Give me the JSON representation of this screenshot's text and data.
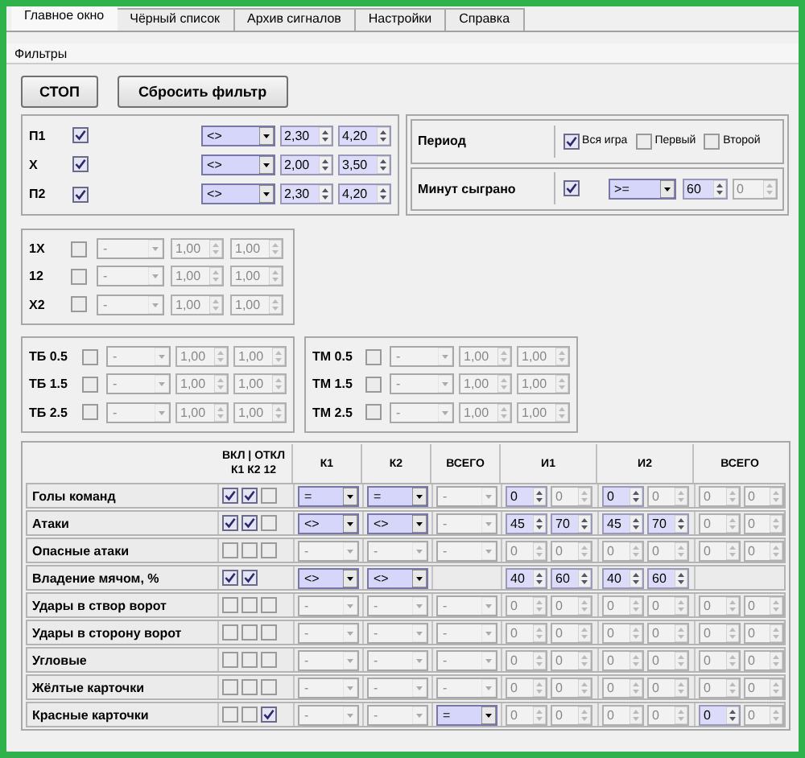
{
  "tabs": [
    {
      "label": "Главное окно",
      "selected": true
    },
    {
      "label": "Чёрный список",
      "selected": false
    },
    {
      "label": "Архив сигналов",
      "selected": false
    },
    {
      "label": "Настройки",
      "selected": false
    },
    {
      "label": "Справка",
      "selected": false
    }
  ],
  "section_title": "Фильтры",
  "buttons": [
    "СТОП",
    "Сбросить фильтр"
  ],
  "odds": {
    "rows": [
      {
        "label": "П1",
        "checked": true,
        "operator": {
          "value": "<>",
          "enabled": true
        },
        "from": {
          "value": "2,30",
          "enabled": true
        },
        "to": {
          "value": "4,20",
          "enabled": true
        }
      },
      {
        "label": "Х",
        "checked": true,
        "operator": {
          "value": "<>",
          "enabled": true
        },
        "from": {
          "value": "2,00",
          "enabled": true
        },
        "to": {
          "value": "3,50",
          "enabled": true
        }
      },
      {
        "label": "П2",
        "checked": true,
        "operator": {
          "value": "<>",
          "enabled": true
        },
        "from": {
          "value": "2,30",
          "enabled": true
        },
        "to": {
          "value": "4,20",
          "enabled": true
        }
      }
    ]
  },
  "period": {
    "label": "Период",
    "options": [
      {
        "label": "Вся игра",
        "checked": true
      },
      {
        "label": "Первый",
        "checked": false
      },
      {
        "label": "Второй",
        "checked": false
      }
    ]
  },
  "minutes": {
    "label": "Минут сыграно",
    "checked": true,
    "operator": {
      "value": ">=",
      "enabled": true
    },
    "from": {
      "value": "60",
      "enabled": true
    },
    "to": {
      "value": "0",
      "enabled": false
    }
  },
  "double_chance": {
    "rows": [
      {
        "label": "1Х",
        "checked": false,
        "operator": {
          "value": "-",
          "enabled": false
        },
        "from": {
          "value": "1,00",
          "enabled": false
        },
        "to": {
          "value": "1,00",
          "enabled": false
        }
      },
      {
        "label": "12",
        "checked": false,
        "operator": {
          "value": "-",
          "enabled": false
        },
        "from": {
          "value": "1,00",
          "enabled": false
        },
        "to": {
          "value": "1,00",
          "enabled": false
        }
      },
      {
        "label": "Х2",
        "checked": false,
        "operator": {
          "value": "-",
          "enabled": false
        },
        "from": {
          "value": "1,00",
          "enabled": false
        },
        "to": {
          "value": "1,00",
          "enabled": false
        }
      }
    ]
  },
  "totals_over": {
    "rows": [
      {
        "label": "ТБ 0.5",
        "checked": false,
        "operator": {
          "value": "-",
          "enabled": false
        },
        "from": {
          "value": "1,00",
          "enabled": false
        },
        "to": {
          "value": "1,00",
          "enabled": false
        }
      },
      {
        "label": "ТБ 1.5",
        "checked": false,
        "operator": {
          "value": "-",
          "enabled": false
        },
        "from": {
          "value": "1,00",
          "enabled": false
        },
        "to": {
          "value": "1,00",
          "enabled": false
        }
      },
      {
        "label": "ТБ 2.5",
        "checked": false,
        "operator": {
          "value": "-",
          "enabled": false
        },
        "from": {
          "value": "1,00",
          "enabled": false
        },
        "to": {
          "value": "1,00",
          "enabled": false
        }
      }
    ]
  },
  "totals_under": {
    "rows": [
      {
        "label": "ТМ 0.5",
        "checked": false,
        "operator": {
          "value": "-",
          "enabled": false
        },
        "from": {
          "value": "1,00",
          "enabled": false
        },
        "to": {
          "value": "1,00",
          "enabled": false
        }
      },
      {
        "label": "ТМ 1.5",
        "checked": false,
        "operator": {
          "value": "-",
          "enabled": false
        },
        "from": {
          "value": "1,00",
          "enabled": false
        },
        "to": {
          "value": "1,00",
          "enabled": false
        }
      },
      {
        "label": "ТМ 2.5",
        "checked": false,
        "operator": {
          "value": "-",
          "enabled": false
        },
        "from": {
          "value": "1,00",
          "enabled": false
        },
        "to": {
          "value": "1,00",
          "enabled": false
        }
      }
    ]
  },
  "stats": {
    "header": {
      "toggle_title": "ВКЛ | ОТКЛ",
      "toggle_subtitle": "К1 К2 12",
      "columns": [
        "К1",
        "К2",
        "ВСЕГО",
        "И1",
        "И2",
        "ВСЕГО"
      ]
    },
    "rows": [
      {
        "label": "Голы команд",
        "checks": [
          {
            "checked": true
          },
          {
            "checked": true
          },
          {
            "checked": false
          }
        ],
        "k1": {
          "value": "=",
          "enabled": true
        },
        "k2": {
          "value": "=",
          "enabled": true
        },
        "total": {
          "value": "-",
          "enabled": false
        },
        "i1": [
          {
            "value": "0",
            "enabled": true
          },
          {
            "value": "0",
            "enabled": false
          }
        ],
        "i2": [
          {
            "value": "0",
            "enabled": true
          },
          {
            "value": "0",
            "enabled": false
          }
        ],
        "sum": [
          {
            "value": "0",
            "enabled": false
          },
          {
            "value": "0",
            "enabled": false
          }
        ]
      },
      {
        "label": "Атаки",
        "checks": [
          {
            "checked": true
          },
          {
            "checked": true
          },
          {
            "checked": false
          }
        ],
        "k1": {
          "value": "<>",
          "enabled": true
        },
        "k2": {
          "value": "<>",
          "enabled": true
        },
        "total": {
          "value": "-",
          "enabled": false
        },
        "i1": [
          {
            "value": "45",
            "enabled": true
          },
          {
            "value": "70",
            "enabled": true
          }
        ],
        "i2": [
          {
            "value": "45",
            "enabled": true
          },
          {
            "value": "70",
            "enabled": true
          }
        ],
        "sum": [
          {
            "value": "0",
            "enabled": false
          },
          {
            "value": "0",
            "enabled": false
          }
        ]
      },
      {
        "label": "Опасные атаки",
        "checks": [
          {
            "checked": false
          },
          {
            "checked": false
          },
          {
            "checked": false
          }
        ],
        "k1": {
          "value": "-",
          "enabled": false
        },
        "k2": {
          "value": "-",
          "enabled": false
        },
        "total": {
          "value": "-",
          "enabled": false
        },
        "i1": [
          {
            "value": "0",
            "enabled": false
          },
          {
            "value": "0",
            "enabled": false
          }
        ],
        "i2": [
          {
            "value": "0",
            "enabled": false
          },
          {
            "value": "0",
            "enabled": false
          }
        ],
        "sum": [
          {
            "value": "0",
            "enabled": false
          },
          {
            "value": "0",
            "enabled": false
          }
        ]
      },
      {
        "label": "Владение мячом, %",
        "checks": [
          {
            "checked": true
          },
          {
            "checked": true
          }
        ],
        "k1": {
          "value": "<>",
          "enabled": true
        },
        "k2": {
          "value": "<>",
          "enabled": true
        },
        "i1": [
          {
            "value": "40",
            "enabled": true
          },
          {
            "value": "60",
            "enabled": true
          }
        ],
        "i2": [
          {
            "value": "40",
            "enabled": true
          },
          {
            "value": "60",
            "enabled": true
          }
        ]
      },
      {
        "label": "Удары в створ ворот",
        "checks": [
          {
            "checked": false
          },
          {
            "checked": false
          },
          {
            "checked": false
          }
        ],
        "k1": {
          "value": "-",
          "enabled": false
        },
        "k2": {
          "value": "-",
          "enabled": false
        },
        "total": {
          "value": "-",
          "enabled": false
        },
        "i1": [
          {
            "value": "0",
            "enabled": false
          },
          {
            "value": "0",
            "enabled": false
          }
        ],
        "i2": [
          {
            "value": "0",
            "enabled": false
          },
          {
            "value": "0",
            "enabled": false
          }
        ],
        "sum": [
          {
            "value": "0",
            "enabled": false
          },
          {
            "value": "0",
            "enabled": false
          }
        ]
      },
      {
        "label": "Удары в сторону ворот",
        "checks": [
          {
            "checked": false
          },
          {
            "checked": false
          },
          {
            "checked": false
          }
        ],
        "k1": {
          "value": "-",
          "enabled": false
        },
        "k2": {
          "value": "-",
          "enabled": false
        },
        "total": {
          "value": "-",
          "enabled": false
        },
        "i1": [
          {
            "value": "0",
            "enabled": false
          },
          {
            "value": "0",
            "enabled": false
          }
        ],
        "i2": [
          {
            "value": "0",
            "enabled": false
          },
          {
            "value": "0",
            "enabled": false
          }
        ],
        "sum": [
          {
            "value": "0",
            "enabled": false
          },
          {
            "value": "0",
            "enabled": false
          }
        ]
      },
      {
        "label": "Угловые",
        "checks": [
          {
            "checked": false
          },
          {
            "checked": false
          },
          {
            "checked": false
          }
        ],
        "k1": {
          "value": "-",
          "enabled": false
        },
        "k2": {
          "value": "-",
          "enabled": false
        },
        "total": {
          "value": "-",
          "enabled": false
        },
        "i1": [
          {
            "value": "0",
            "enabled": false
          },
          {
            "value": "0",
            "enabled": false
          }
        ],
        "i2": [
          {
            "value": "0",
            "enabled": false
          },
          {
            "value": "0",
            "enabled": false
          }
        ],
        "sum": [
          {
            "value": "0",
            "enabled": false
          },
          {
            "value": "0",
            "enabled": false
          }
        ]
      },
      {
        "label": "Жёлтые карточки",
        "checks": [
          {
            "checked": false
          },
          {
            "checked": false
          },
          {
            "checked": false
          }
        ],
        "k1": {
          "value": "-",
          "enabled": false
        },
        "k2": {
          "value": "-",
          "enabled": false
        },
        "total": {
          "value": "-",
          "enabled": false
        },
        "i1": [
          {
            "value": "0",
            "enabled": false
          },
          {
            "value": "0",
            "enabled": false
          }
        ],
        "i2": [
          {
            "value": "0",
            "enabled": false
          },
          {
            "value": "0",
            "enabled": false
          }
        ],
        "sum": [
          {
            "value": "0",
            "enabled": false
          },
          {
            "value": "0",
            "enabled": false
          }
        ]
      },
      {
        "label": "Красные карточки",
        "checks": [
          {
            "checked": false
          },
          {
            "checked": false
          },
          {
            "checked": true
          }
        ],
        "k1": {
          "value": "-",
          "enabled": false
        },
        "k2": {
          "value": "-",
          "enabled": false
        },
        "total": {
          "value": "=",
          "enabled": true
        },
        "i1": [
          {
            "value": "0",
            "enabled": false
          },
          {
            "value": "0",
            "enabled": false
          }
        ],
        "i2": [
          {
            "value": "0",
            "enabled": false
          },
          {
            "value": "0",
            "enabled": false
          }
        ],
        "sum": [
          {
            "value": "0",
            "enabled": true
          },
          {
            "value": "0",
            "enabled": false
          }
        ]
      }
    ]
  }
}
